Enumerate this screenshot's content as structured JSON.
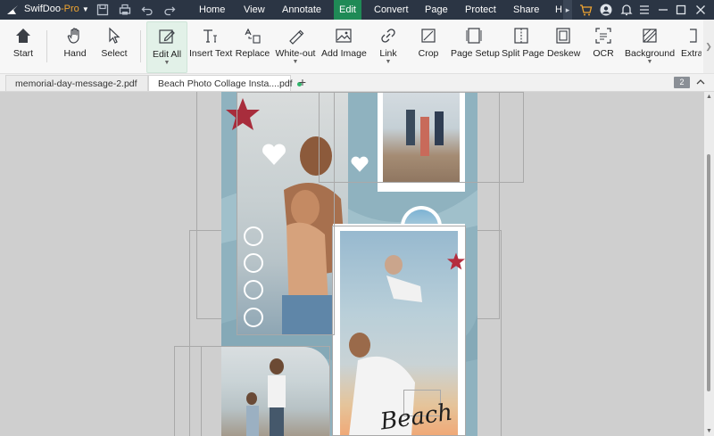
{
  "app": {
    "name": "SwifDoo",
    "edition": "-Pro"
  },
  "menu": [
    "Home",
    "View",
    "Annotate",
    "Edit",
    "Convert",
    "Page",
    "Protect",
    "Share",
    "H"
  ],
  "menu_active": "Edit",
  "tools": {
    "start": "Start",
    "hand": "Hand",
    "select": "Select",
    "edit_all": "Edit All",
    "insert_text": "Insert Text",
    "replace": "Replace",
    "white_out": "White-out",
    "add_image": "Add Image",
    "link": "Link",
    "crop": "Crop",
    "page_setup": "Page Setup",
    "split_page": "Split Page",
    "deskew": "Deskew",
    "ocr": "OCR",
    "background": "Background",
    "extra": "Extra"
  },
  "tabs": [
    {
      "label": "memorial-day-message-2.pdf"
    },
    {
      "label": "Beach Photo Collage Insta....pdf"
    }
  ],
  "add_tab": "+",
  "page_count": "2",
  "canvas": {
    "overlay_text": "Beach"
  },
  "colors": {
    "titlebar": "#2b3544",
    "accent": "#1f8a56",
    "edition": "#f0a531",
    "page": "#8fb2bf"
  }
}
